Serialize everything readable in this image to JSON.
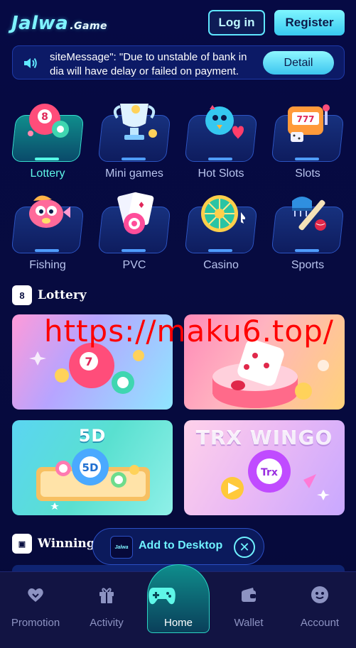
{
  "header": {
    "logo_main": "Jalwa",
    "logo_sub": ".Game",
    "login_label": "Log in",
    "register_label": "Register"
  },
  "notice": {
    "icon": "speaker-icon",
    "text": "siteMessage\": \"Due to unstable of bank in dia will have delay or failed on payment.",
    "detail_label": "Detail"
  },
  "categories": [
    {
      "label": "Lottery",
      "active": true
    },
    {
      "label": "Mini games"
    },
    {
      "label": "Hot Slots"
    },
    {
      "label": "Slots"
    },
    {
      "label": "Fishing"
    },
    {
      "label": "PVC"
    },
    {
      "label": "Casino"
    },
    {
      "label": "Sports"
    }
  ],
  "lottery_section": {
    "title": "Lottery",
    "cards": [
      {
        "title": ""
      },
      {
        "title": ""
      },
      {
        "title": "5D"
      },
      {
        "title": "TRX WINGO"
      }
    ]
  },
  "watermark": "https://maku6.top/",
  "winning_section": {
    "title": "Winning i"
  },
  "add_desktop": {
    "mini_logo": "Jalwa",
    "label": "Add to Desktop"
  },
  "bottom_nav": [
    {
      "label": "Promotion"
    },
    {
      "label": "Activity"
    },
    {
      "label": "Home",
      "active": true
    },
    {
      "label": "Wallet"
    },
    {
      "label": "Account"
    }
  ],
  "colors": {
    "background": "#06093f",
    "accent": "#5fe7ff",
    "active_text": "#5ff7e8"
  }
}
